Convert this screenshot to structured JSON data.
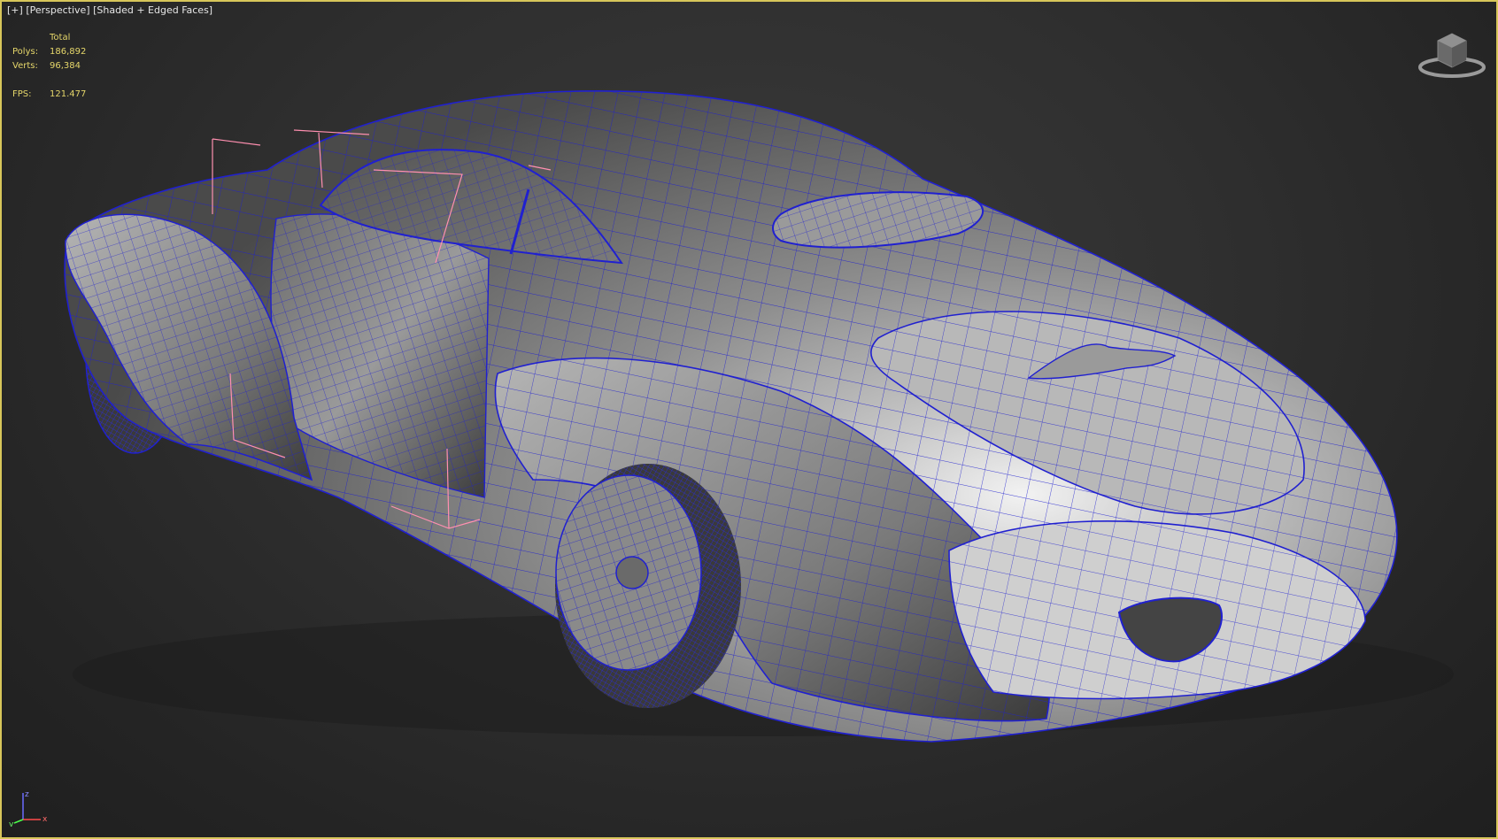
{
  "viewport": {
    "menu_plus": "[+]",
    "menu_view": "[Perspective]",
    "menu_shading": "[Shaded + Edged Faces]"
  },
  "stats": {
    "header": "Total",
    "polys_label": "Polys:",
    "polys_value": "186,892",
    "verts_label": "Verts:",
    "verts_value": "96,384",
    "fps_label": "FPS:",
    "fps_value": "121.477"
  },
  "viewcube": {
    "icon": "viewcube-icon"
  },
  "axis": {
    "z": "z",
    "x": "x",
    "y": "y"
  },
  "colors": {
    "frame_border": "#d7c65a",
    "stats_text": "#e5d66a",
    "wire": "#2020d0",
    "selection_brackets": "#ff8fb0"
  }
}
